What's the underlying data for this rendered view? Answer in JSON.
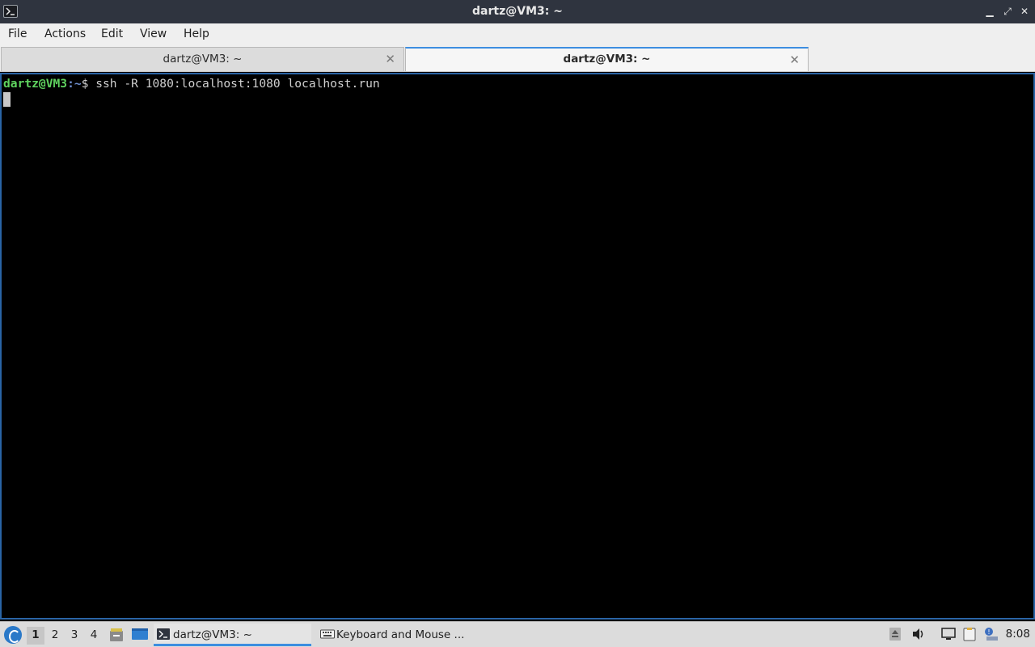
{
  "window": {
    "title": "dartz@VM3: ~",
    "minimize": "▁",
    "maximize": "⤢",
    "close": "✕"
  },
  "menu": [
    "File",
    "Actions",
    "Edit",
    "View",
    "Help"
  ],
  "tabs": [
    {
      "label": "dartz@VM3: ~",
      "active": false
    },
    {
      "label": "dartz@VM3: ~",
      "active": true
    }
  ],
  "terminal": {
    "prompt_user": "dartz@VM3",
    "prompt_path": ":~",
    "prompt_symbol": "$ ",
    "command": "ssh -R 1080:localhost:1080 localhost.run"
  },
  "taskbar": {
    "workspaces": [
      "1",
      "2",
      "3",
      "4"
    ],
    "current_workspace": "1",
    "tasks": [
      {
        "label": "dartz@VM3: ~",
        "icon": "terminal-icon",
        "active": true
      },
      {
        "label": "Keyboard and Mouse ...",
        "icon": "keyboard-icon",
        "active": false
      }
    ],
    "clock": "8:08"
  },
  "colors": {
    "titlebar": "#2f343f",
    "terminal_bg": "#000000",
    "prompt_user": "#5fd35f",
    "prompt_path": "#6f8fcf",
    "accent": "#3d8ee0"
  }
}
